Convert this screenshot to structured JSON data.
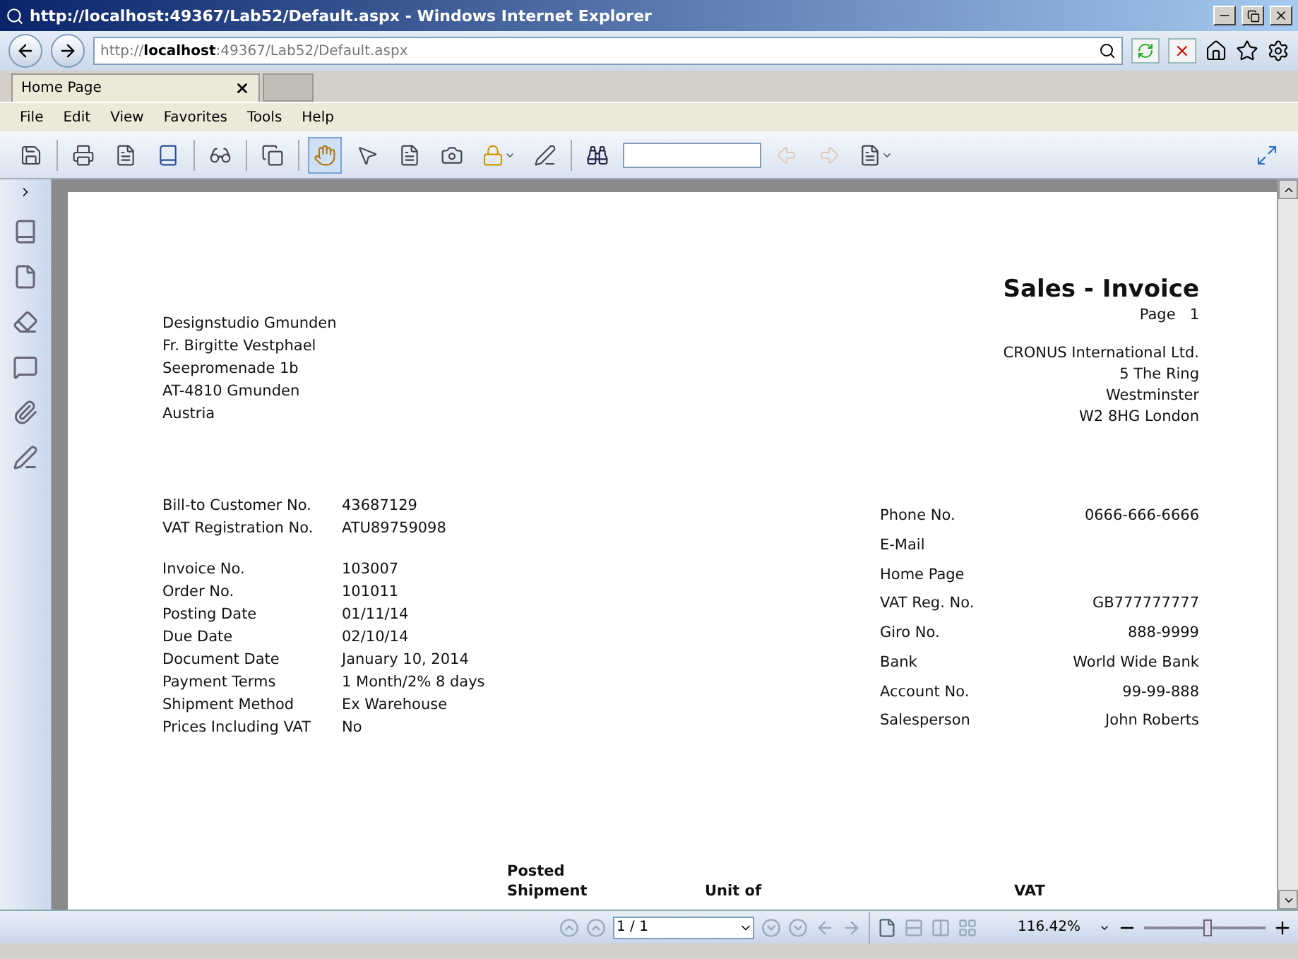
{
  "window": {
    "title": "http://localhost:49367/Lab52/Default.aspx - Windows Internet Explorer"
  },
  "address": {
    "url": "http://**localhost**:49367/Lab52/Default.aspx"
  },
  "tabs": [
    {
      "label": "Home Page",
      "selected": true
    }
  ],
  "menu": [
    "File",
    "Edit",
    "View",
    "Favorites",
    "Tools",
    "Help"
  ],
  "report": {
    "title": "Sales - Invoice",
    "page_label": "Page",
    "page_number": "1",
    "customer_address": [
      "Designstudio Gmunden",
      "Fr. Birgitte Vestphael",
      "Seepromenade 1b",
      "AT-4810 Gmunden",
      "Austria"
    ],
    "company_address": [
      "CRONUS International Ltd.",
      "5 The Ring",
      "Westminster",
      "W2 8HG London"
    ],
    "customer_fields": [
      [
        {
          "label": "Bill-to Customer No.",
          "value": "43687129"
        },
        {
          "label": "VAT Registration No.",
          "value": "ATU89759098"
        }
      ],
      [
        {
          "label": "Invoice No.",
          "value": "103007"
        },
        {
          "label": "Order No.",
          "value": "101011"
        },
        {
          "label": "Posting Date",
          "value": "01/11/14"
        },
        {
          "label": "Due Date",
          "value": "02/10/14"
        },
        {
          "label": "Document Date",
          "value": "January 10, 2014"
        },
        {
          "label": "Payment Terms",
          "value": "1 Month/2% 8 days"
        },
        {
          "label": "Shipment Method",
          "value": "Ex Warehouse"
        },
        {
          "label": "Prices Including VAT",
          "value": "No"
        }
      ]
    ],
    "company_fields": [
      {
        "label": "Phone No.",
        "value": "0666-666-6666"
      },
      {
        "label": "E-Mail"
      },
      {
        "label": "Home Page"
      },
      {
        "label": "VAT Reg. No.",
        "value": "GB777777777"
      },
      {
        "label": "Giro No.",
        "value": "888-9999"
      },
      {
        "label": "Bank",
        "value": "World Wide Bank"
      },
      {
        "label": "Account No.",
        "value": "99-99-888"
      },
      {
        "label": "Salesperson",
        "value": "John Roberts"
      }
    ],
    "table": {
      "columns": [
        {},
        {},
        {
          "lines": [
            "Posted",
            "Shipment"
          ]
        },
        {},
        {
          "lines": [
            "Unit of"
          ]
        },
        {},
        {},
        {
          "lines": [
            "VAT"
          ]
        },
        {}
      ]
    }
  },
  "navigation": {
    "page": "1 / 1",
    "zoom": "116.42%",
    "zoom_slider": {
      "level": 0.52
    }
  }
}
